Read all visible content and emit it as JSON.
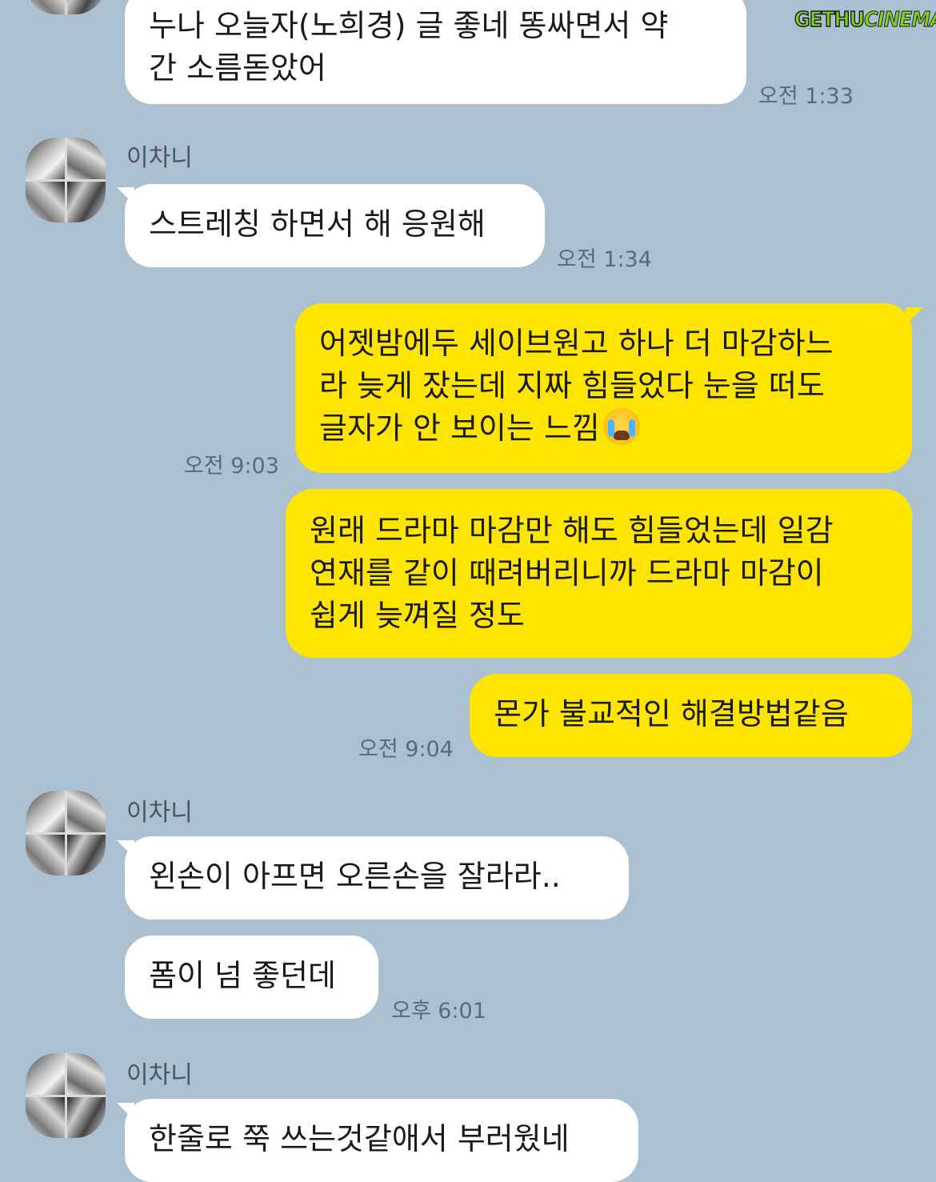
{
  "watermark": {
    "part1": "GETHU",
    "part2": "CINEMA"
  },
  "messages": [
    {
      "id": "m1",
      "direction": "incoming",
      "lines": [
        "누나 오늘자(노희경) 글 좋네 똥싸면서 약",
        "간 소름돋았어"
      ],
      "time": "오전 1:33"
    },
    {
      "id": "m2",
      "direction": "incoming",
      "sender": "이차니",
      "lines": [
        "스트레칭 하면서 해 응원해"
      ],
      "time": "오전 1:34"
    },
    {
      "id": "m3",
      "direction": "outgoing",
      "lines": [
        "어젯밤에두 세이브원고 하나 더 마감하느",
        "라 늦게 잤는데 지짜 힘들었다 눈을 떠도",
        "글자가 안 보이는 느낌"
      ],
      "emoji": "loudly-crying-face",
      "time": "오전 9:03"
    },
    {
      "id": "m4",
      "direction": "outgoing",
      "lines": [
        "원래 드라마 마감만 해도 힘들었는데 일감",
        "연재를 같이 때려버리니까 드라마 마감이",
        "쉽게 늦껴질 정도"
      ]
    },
    {
      "id": "m5",
      "direction": "outgoing",
      "lines": [
        "몬가 불교적인 해결방법같음"
      ],
      "time": "오전 9:04"
    },
    {
      "id": "m6",
      "direction": "incoming",
      "sender": "이차니",
      "lines": [
        "왼손이 아프면 오른손을 잘라라.."
      ]
    },
    {
      "id": "m7",
      "direction": "incoming",
      "lines": [
        "폼이 넘 좋던데"
      ],
      "time": "오후 6:01"
    },
    {
      "id": "m8",
      "direction": "incoming",
      "sender": "이차니",
      "lines": [
        "한줄로 쭉 쓰는것같애서 부러웠네"
      ]
    }
  ]
}
